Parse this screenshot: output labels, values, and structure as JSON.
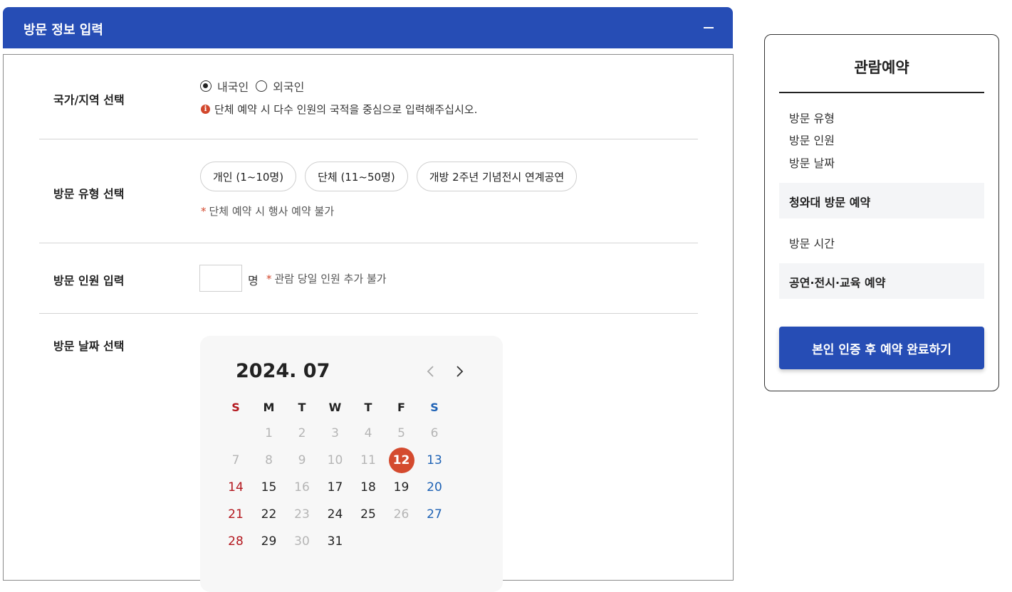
{
  "panel": {
    "title": "방문 정보 입력"
  },
  "nationality": {
    "label": "국가/지역 선택",
    "options": [
      "내국인",
      "외국인"
    ],
    "selected": "내국인",
    "note": "단체 예약 시 다수 인원의 국적을 중심으로 입력해주십시오."
  },
  "visit_type": {
    "label": "방문 유형 선택",
    "options": [
      "개인 (1~10명)",
      "단체 (11~50명)",
      "개방 2주년 기념전시 연계공연"
    ],
    "note": "단체 예약 시 행사 예약 불가"
  },
  "visitors": {
    "label": "방문 인원 입력",
    "value": "",
    "unit": "명",
    "note": "관람 당일 인원 추가 불가"
  },
  "date": {
    "label": "방문 날짜 선택",
    "month_title": "2024. 07",
    "weekdays": [
      "S",
      "M",
      "T",
      "W",
      "T",
      "F",
      "S"
    ],
    "weeks": [
      [
        "",
        "1",
        "2",
        "3",
        "4",
        "5",
        "6"
      ],
      [
        "7",
        "8",
        "9",
        "10",
        "11",
        "12",
        "13"
      ],
      [
        "14",
        "15",
        "16",
        "17",
        "18",
        "19",
        "20"
      ],
      [
        "21",
        "22",
        "23",
        "24",
        "25",
        "26",
        "27"
      ],
      [
        "28",
        "29",
        "30",
        "31",
        "",
        "",
        ""
      ]
    ],
    "selected_day": "12",
    "unavailable_days": [
      "1",
      "2",
      "3",
      "4",
      "5",
      "6",
      "7",
      "8",
      "9",
      "10",
      "11",
      "16",
      "23",
      "26",
      "30"
    ],
    "colors": {
      "sunday": "#b3171e",
      "saturday": "#1e62b5",
      "selected": "#d44a2e",
      "disabled": "#b5b5b5"
    }
  },
  "summary": {
    "title": "관람예약",
    "items_top": [
      "방문 유형",
      "방문 인원",
      "방문 날짜"
    ],
    "section1": "청와대 방문 예약",
    "item_mid": "방문 시간",
    "section2": "공연·전시·교육 예약",
    "cta": "본인 인증 후 예약 완료하기"
  },
  "colors": {
    "brand": "#264db5",
    "accent": "#d2472c"
  }
}
